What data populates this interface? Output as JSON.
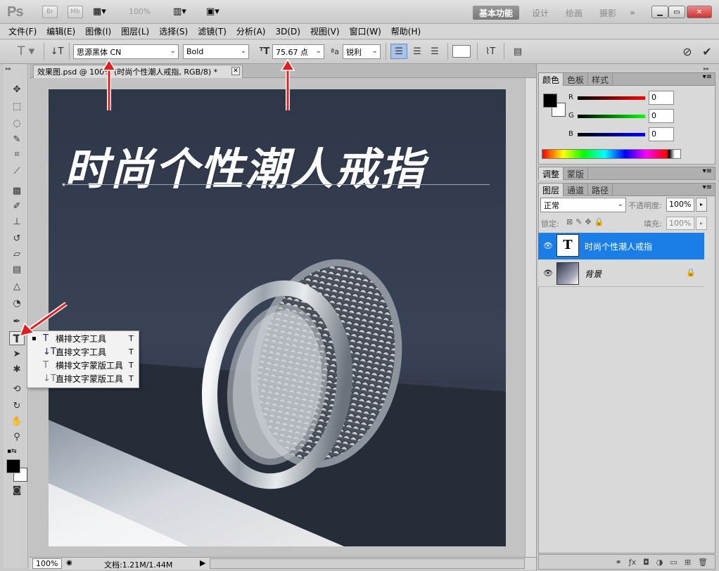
{
  "app": {
    "logo": "Ps",
    "br": "Br",
    "mb": "Mb",
    "zoom": "100%"
  },
  "workspaces": [
    "基本功能",
    "设计",
    "绘画",
    "摄影",
    "»"
  ],
  "menu": [
    "文件(F)",
    "编辑(E)",
    "图像(I)",
    "图层(L)",
    "选择(S)",
    "滤镜(T)",
    "分析(A)",
    "3D(D)",
    "视图(V)",
    "窗口(W)",
    "帮助(H)"
  ],
  "options": {
    "font_family": "思源黑体 CN",
    "font_style": "Bold",
    "font_size": "75.67 点",
    "aa_label": "ªa",
    "antialias": "锐利"
  },
  "document": {
    "tab_title": "效果图.psd @ 100% (时尚个性潮人戒指, RGB/8) *",
    "headline": "时尚个性潮人戒指",
    "status_zoom": "100%",
    "status_doc": "文档:1.21M/1.44M"
  },
  "tool_flyout": [
    {
      "icon": "T",
      "label": "横排文字工具",
      "key": "T",
      "selected": true
    },
    {
      "icon": "↓T",
      "label": "直排文字工具",
      "key": "T",
      "selected": false
    },
    {
      "icon": "T",
      "label": "横排文字蒙版工具",
      "key": "T",
      "selected": false
    },
    {
      "icon": "↓T",
      "label": "直排文字蒙版工具",
      "key": "T",
      "selected": false
    }
  ],
  "color_panel": {
    "tabs": [
      "颜色",
      "色板",
      "样式"
    ],
    "channels": [
      {
        "label": "R",
        "value": "0",
        "color": "#ff0000"
      },
      {
        "label": "G",
        "value": "0",
        "color": "#00ff00"
      },
      {
        "label": "B",
        "value": "0",
        "color": "#0000ff"
      }
    ]
  },
  "adjust_tabs": [
    "调整",
    "蒙版"
  ],
  "layers_panel": {
    "tabs": [
      "图层",
      "通道",
      "路径"
    ],
    "blend_mode": "正常",
    "opacity_label": "不透明度:",
    "opacity": "100%",
    "lock_label": "锁定:",
    "fill_label": "填充:",
    "fill": "100%",
    "layers": [
      {
        "name": "时尚个性潮人戒指",
        "thumb": "T",
        "selected": true
      },
      {
        "name": "背景",
        "thumb": "",
        "selected": false
      }
    ]
  },
  "colors": {
    "accent": "#1a7ee6",
    "arrow": "#e02020"
  }
}
